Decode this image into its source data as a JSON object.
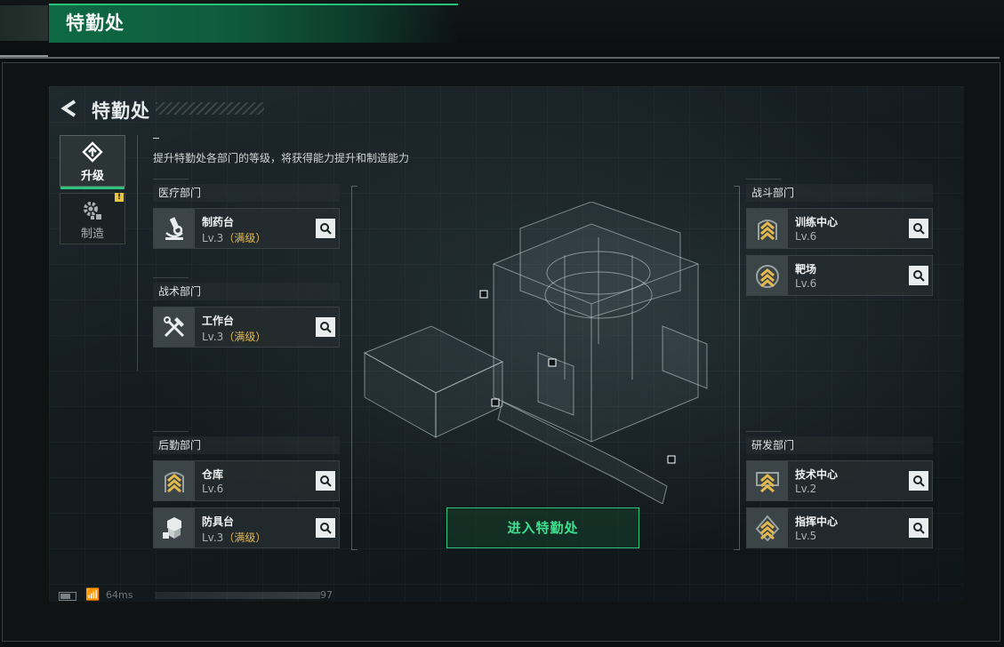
{
  "window": {
    "title": "特勤处"
  },
  "page": {
    "title": "特勤处",
    "description": "提升特勤处各部门的等级，将获得能力提升和制造能力",
    "enter_button": "进入特勤处"
  },
  "tabs": [
    {
      "label": "升级",
      "icon": "upgrade-icon",
      "active": true
    },
    {
      "label": "制造",
      "icon": "gear-icon",
      "active": false,
      "alert": "!"
    }
  ],
  "departments": {
    "medical": {
      "header": "医疗部门",
      "items": [
        {
          "name": "制药台",
          "level": "Lv.3",
          "maxed": "（满级）",
          "icon": "microscope-icon"
        }
      ]
    },
    "tactical": {
      "header": "战术部门",
      "items": [
        {
          "name": "工作台",
          "level": "Lv.3",
          "maxed": "（满级）",
          "icon": "tools-icon"
        }
      ]
    },
    "logistics": {
      "header": "后勤部门",
      "items": [
        {
          "name": "仓库",
          "level": "Lv.6",
          "maxed": "",
          "icon": "rank-chevron-icon"
        },
        {
          "name": "防具台",
          "level": "Lv.3",
          "maxed": "（满级）",
          "icon": "boxes-icon"
        }
      ]
    },
    "combat": {
      "header": "战斗部门",
      "items": [
        {
          "name": "训练中心",
          "level": "Lv.6",
          "maxed": "",
          "icon": "rank-chevron-icon"
        },
        {
          "name": "靶场",
          "level": "Lv.6",
          "maxed": "",
          "icon": "rank-chevron-icon"
        }
      ]
    },
    "research": {
      "header": "研发部门",
      "items": [
        {
          "name": "技术中心",
          "level": "Lv.2",
          "maxed": "",
          "icon": "rank-chevron-icon"
        },
        {
          "name": "指挥中心",
          "level": "Lv.5",
          "maxed": "",
          "icon": "rank-chevron-icon"
        }
      ]
    }
  },
  "status_bar": {
    "ping": "64ms",
    "uid_suffix": "97"
  },
  "colors": {
    "accent_green": "#2ec27d",
    "maxed_gold": "#e5b94e",
    "alert_yellow": "#e9c442"
  }
}
